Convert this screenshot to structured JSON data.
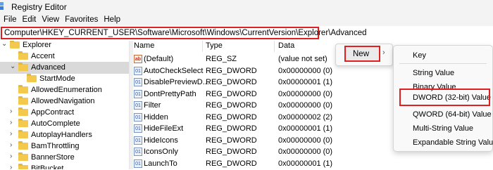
{
  "window": {
    "title": "Registry Editor"
  },
  "menu": [
    "File",
    "Edit",
    "View",
    "Favorites",
    "Help"
  ],
  "address": "Computer\\HKEY_CURRENT_USER\\Software\\Microsoft\\Windows\\CurrentVersion\\Explorer\\Advanced",
  "tree": [
    {
      "label": "Explorer",
      "chevron": "down"
    },
    {
      "label": "Accent",
      "chevron": ""
    },
    {
      "label": "Advanced",
      "chevron": "down",
      "selected": true
    },
    {
      "label": "StartMode",
      "chevron": ""
    },
    {
      "label": "AllowedEnumeration",
      "chevron": ""
    },
    {
      "label": "AllowedNavigation",
      "chevron": ""
    },
    {
      "label": "AppContract",
      "chevron": "right"
    },
    {
      "label": "AutoComplete",
      "chevron": "right"
    },
    {
      "label": "AutoplayHandlers",
      "chevron": "right"
    },
    {
      "label": "BamThrottling",
      "chevron": "right"
    },
    {
      "label": "BannerStore",
      "chevron": "right"
    },
    {
      "label": "BitBucket",
      "chevron": "right"
    }
  ],
  "columns": {
    "name": "Name",
    "type": "Type",
    "data": "Data"
  },
  "values": [
    {
      "icon": "string-value-icon",
      "name": "(Default)",
      "type": "REG_SZ",
      "data": "(value not set)"
    },
    {
      "icon": "binary-value-icon",
      "name": "AutoCheckSelect",
      "type": "REG_DWORD",
      "data": "0x00000000 (0)"
    },
    {
      "icon": "binary-value-icon",
      "name": "DisablePreviewD...",
      "type": "REG_DWORD",
      "data": "0x00000001 (1)"
    },
    {
      "icon": "binary-value-icon",
      "name": "DontPrettyPath",
      "type": "REG_DWORD",
      "data": "0x00000000 (0)"
    },
    {
      "icon": "binary-value-icon",
      "name": "Filter",
      "type": "REG_DWORD",
      "data": "0x00000000 (0)"
    },
    {
      "icon": "binary-value-icon",
      "name": "Hidden",
      "type": "REG_DWORD",
      "data": "0x00000002 (2)"
    },
    {
      "icon": "binary-value-icon",
      "name": "HideFileExt",
      "type": "REG_DWORD",
      "data": "0x00000001 (1)"
    },
    {
      "icon": "binary-value-icon",
      "name": "HideIcons",
      "type": "REG_DWORD",
      "data": "0x00000000 (0)"
    },
    {
      "icon": "binary-value-icon",
      "name": "IconsOnly",
      "type": "REG_DWORD",
      "data": "0x00000000 (0)"
    },
    {
      "icon": "binary-value-icon",
      "name": "LaunchTo",
      "type": "REG_DWORD",
      "data": "0x00000001 (1)"
    }
  ],
  "context_menu": {
    "new_label": "New"
  },
  "new_submenu": [
    "Key",
    "String Value",
    "Binary Value",
    "DWORD (32-bit) Value",
    "QWORD (64-bit) Value",
    "Multi-String Value",
    "Expandable String Value"
  ],
  "colors": {
    "highlight_box": "#e02020",
    "folder": "#f2c94c",
    "selection": "#d9d9d9"
  }
}
